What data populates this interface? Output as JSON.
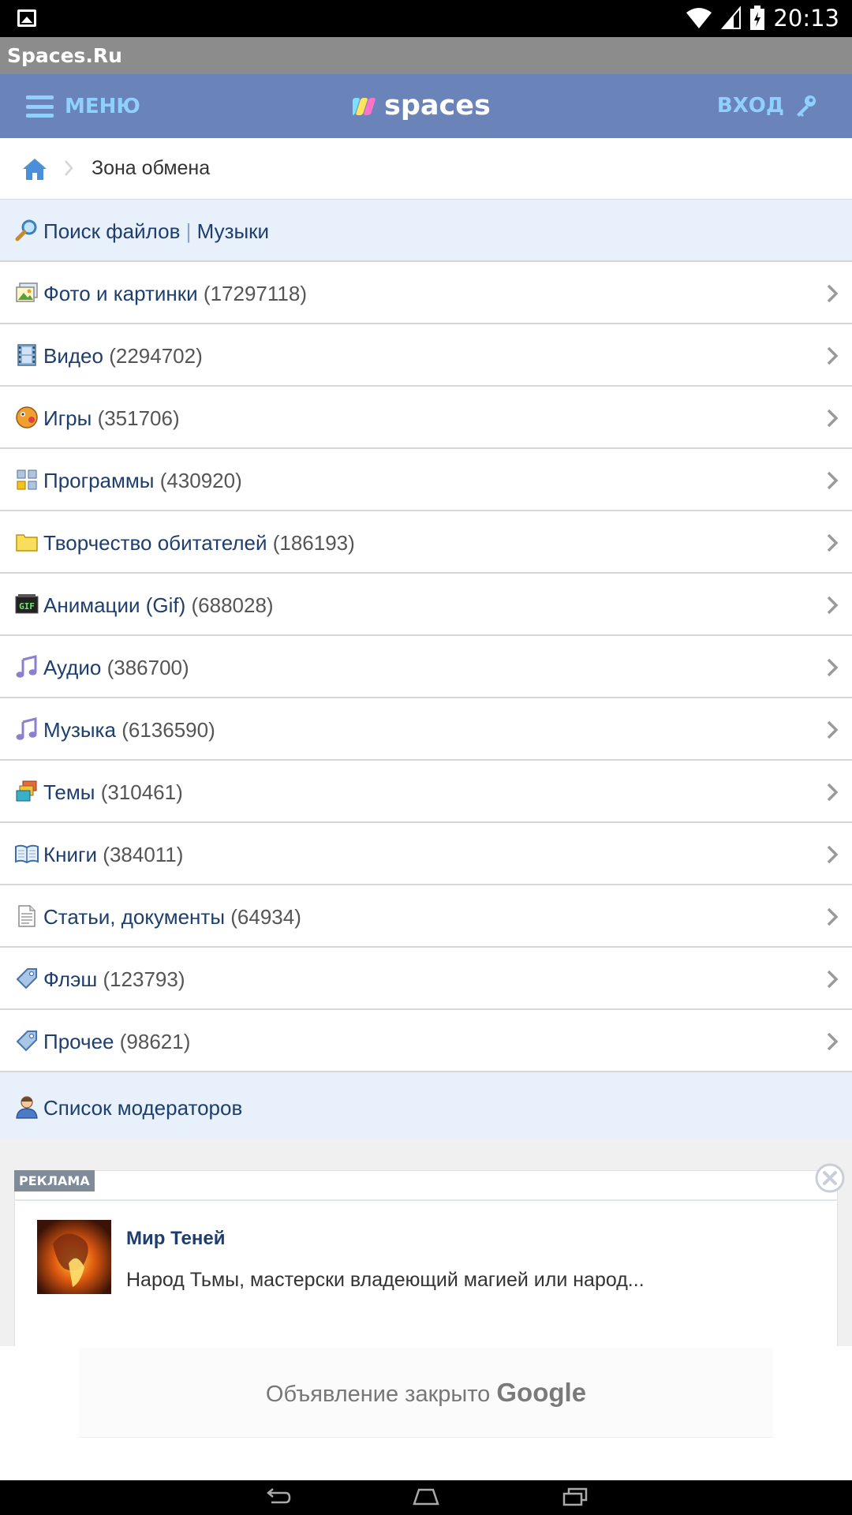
{
  "status_bar": {
    "time": "20:13"
  },
  "window": {
    "title": "Spaces.Ru"
  },
  "header": {
    "menu_label": "МЕНЮ",
    "logo_text": "spaces",
    "login_label": "ВХОД"
  },
  "breadcrumb": {
    "current": "Зона обмена"
  },
  "search": {
    "files_label": "Поиск файлов",
    "separator": "|",
    "music_label": "Музыки"
  },
  "categories": [
    {
      "label": "Фото и картинки",
      "count": "(17297118)"
    },
    {
      "label": "Видео",
      "count": "(2294702)"
    },
    {
      "label": "Игры",
      "count": "(351706)"
    },
    {
      "label": "Программы",
      "count": "(430920)"
    },
    {
      "label": "Творчество обитателей",
      "count": "(186193)"
    },
    {
      "label": "Анимации (Gif)",
      "count": "(688028)"
    },
    {
      "label": "Аудио",
      "count": "(386700)"
    },
    {
      "label": "Музыка",
      "count": "(6136590)"
    },
    {
      "label": "Темы",
      "count": "(310461)"
    },
    {
      "label": "Книги",
      "count": "(384011)"
    },
    {
      "label": "Статьи, документы",
      "count": "(64934)"
    },
    {
      "label": "Флэш",
      "count": "(123793)"
    },
    {
      "label": "Прочее",
      "count": "(98621)"
    }
  ],
  "moderators": {
    "label": "Список модераторов"
  },
  "ad": {
    "tag": "РЕКЛАМА",
    "title": "Мир Теней",
    "description": "Народ Тьмы, мастерски владеющий магией или народ..."
  },
  "google_closed": {
    "message": "Объявление закрыто",
    "brand": "Google"
  },
  "colors": {
    "header_bg": "#6a83b9",
    "accent": "#8fd0ff",
    "link": "#1d3e6e",
    "highlight_row": "#e8f0fb"
  }
}
